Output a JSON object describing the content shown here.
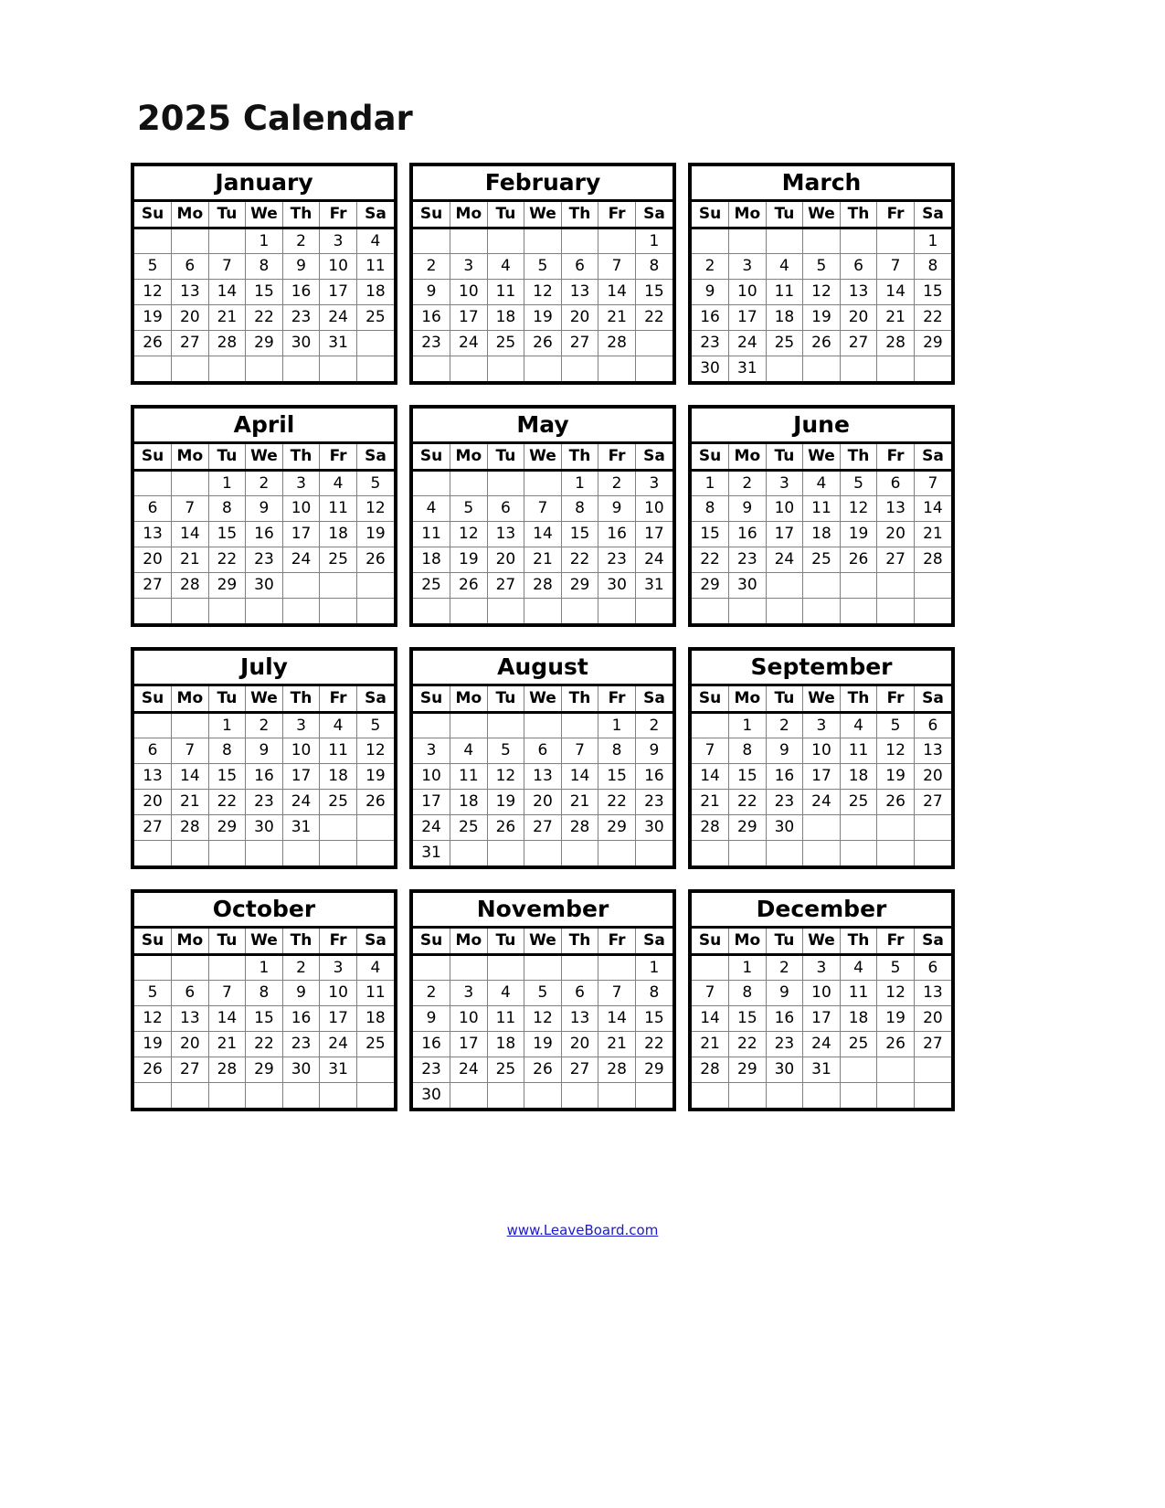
{
  "document": {
    "title": "2025 Calendar",
    "year": 2025
  },
  "weekdays": [
    "Su",
    "Mo",
    "Tu",
    "We",
    "Th",
    "Fr",
    "Sa"
  ],
  "footer": {
    "link_text": "www.LeaveBoard.com",
    "link_color": "#1919D1"
  },
  "months": [
    {
      "name": "January",
      "weeks": [
        [
          "",
          "",
          "",
          "1",
          "2",
          "3",
          "4"
        ],
        [
          "5",
          "6",
          "7",
          "8",
          "9",
          "10",
          "11"
        ],
        [
          "12",
          "13",
          "14",
          "15",
          "16",
          "17",
          "18"
        ],
        [
          "19",
          "20",
          "21",
          "22",
          "23",
          "24",
          "25"
        ],
        [
          "26",
          "27",
          "28",
          "29",
          "30",
          "31",
          ""
        ],
        [
          "",
          "",
          "",
          "",
          "",
          "",
          ""
        ]
      ]
    },
    {
      "name": "February",
      "weeks": [
        [
          "",
          "",
          "",
          "",
          "",
          "",
          "1"
        ],
        [
          "2",
          "3",
          "4",
          "5",
          "6",
          "7",
          "8"
        ],
        [
          "9",
          "10",
          "11",
          "12",
          "13",
          "14",
          "15"
        ],
        [
          "16",
          "17",
          "18",
          "19",
          "20",
          "21",
          "22"
        ],
        [
          "23",
          "24",
          "25",
          "26",
          "27",
          "28",
          ""
        ],
        [
          "",
          "",
          "",
          "",
          "",
          "",
          ""
        ]
      ]
    },
    {
      "name": "March",
      "weeks": [
        [
          "",
          "",
          "",
          "",
          "",
          "",
          "1"
        ],
        [
          "2",
          "3",
          "4",
          "5",
          "6",
          "7",
          "8"
        ],
        [
          "9",
          "10",
          "11",
          "12",
          "13",
          "14",
          "15"
        ],
        [
          "16",
          "17",
          "18",
          "19",
          "20",
          "21",
          "22"
        ],
        [
          "23",
          "24",
          "25",
          "26",
          "27",
          "28",
          "29"
        ],
        [
          "30",
          "31",
          "",
          "",
          "",
          "",
          ""
        ]
      ]
    },
    {
      "name": "April",
      "weeks": [
        [
          "",
          "",
          "1",
          "2",
          "3",
          "4",
          "5"
        ],
        [
          "6",
          "7",
          "8",
          "9",
          "10",
          "11",
          "12"
        ],
        [
          "13",
          "14",
          "15",
          "16",
          "17",
          "18",
          "19"
        ],
        [
          "20",
          "21",
          "22",
          "23",
          "24",
          "25",
          "26"
        ],
        [
          "27",
          "28",
          "29",
          "30",
          "",
          "",
          ""
        ],
        [
          "",
          "",
          "",
          "",
          "",
          "",
          ""
        ]
      ]
    },
    {
      "name": "May",
      "weeks": [
        [
          "",
          "",
          "",
          "",
          "1",
          "2",
          "3"
        ],
        [
          "4",
          "5",
          "6",
          "7",
          "8",
          "9",
          "10"
        ],
        [
          "11",
          "12",
          "13",
          "14",
          "15",
          "16",
          "17"
        ],
        [
          "18",
          "19",
          "20",
          "21",
          "22",
          "23",
          "24"
        ],
        [
          "25",
          "26",
          "27",
          "28",
          "29",
          "30",
          "31"
        ],
        [
          "",
          "",
          "",
          "",
          "",
          "",
          ""
        ]
      ]
    },
    {
      "name": "June",
      "weeks": [
        [
          "1",
          "2",
          "3",
          "4",
          "5",
          "6",
          "7"
        ],
        [
          "8",
          "9",
          "10",
          "11",
          "12",
          "13",
          "14"
        ],
        [
          "15",
          "16",
          "17",
          "18",
          "19",
          "20",
          "21"
        ],
        [
          "22",
          "23",
          "24",
          "25",
          "26",
          "27",
          "28"
        ],
        [
          "29",
          "30",
          "",
          "",
          "",
          "",
          ""
        ],
        [
          "",
          "",
          "",
          "",
          "",
          "",
          ""
        ]
      ]
    },
    {
      "name": "July",
      "weeks": [
        [
          "",
          "",
          "1",
          "2",
          "3",
          "4",
          "5"
        ],
        [
          "6",
          "7",
          "8",
          "9",
          "10",
          "11",
          "12"
        ],
        [
          "13",
          "14",
          "15",
          "16",
          "17",
          "18",
          "19"
        ],
        [
          "20",
          "21",
          "22",
          "23",
          "24",
          "25",
          "26"
        ],
        [
          "27",
          "28",
          "29",
          "30",
          "31",
          "",
          ""
        ],
        [
          "",
          "",
          "",
          "",
          "",
          "",
          ""
        ]
      ]
    },
    {
      "name": "August",
      "weeks": [
        [
          "",
          "",
          "",
          "",
          "",
          "1",
          "2"
        ],
        [
          "3",
          "4",
          "5",
          "6",
          "7",
          "8",
          "9"
        ],
        [
          "10",
          "11",
          "12",
          "13",
          "14",
          "15",
          "16"
        ],
        [
          "17",
          "18",
          "19",
          "20",
          "21",
          "22",
          "23"
        ],
        [
          "24",
          "25",
          "26",
          "27",
          "28",
          "29",
          "30"
        ],
        [
          "31",
          "",
          "",
          "",
          "",
          "",
          ""
        ]
      ]
    },
    {
      "name": "September",
      "weeks": [
        [
          "",
          "1",
          "2",
          "3",
          "4",
          "5",
          "6"
        ],
        [
          "7",
          "8",
          "9",
          "10",
          "11",
          "12",
          "13"
        ],
        [
          "14",
          "15",
          "16",
          "17",
          "18",
          "19",
          "20"
        ],
        [
          "21",
          "22",
          "23",
          "24",
          "25",
          "26",
          "27"
        ],
        [
          "28",
          "29",
          "30",
          "",
          "",
          "",
          ""
        ],
        [
          "",
          "",
          "",
          "",
          "",
          "",
          ""
        ]
      ]
    },
    {
      "name": "October",
      "weeks": [
        [
          "",
          "",
          "",
          "1",
          "2",
          "3",
          "4"
        ],
        [
          "5",
          "6",
          "7",
          "8",
          "9",
          "10",
          "11"
        ],
        [
          "12",
          "13",
          "14",
          "15",
          "16",
          "17",
          "18"
        ],
        [
          "19",
          "20",
          "21",
          "22",
          "23",
          "24",
          "25"
        ],
        [
          "26",
          "27",
          "28",
          "29",
          "30",
          "31",
          ""
        ],
        [
          "",
          "",
          "",
          "",
          "",
          "",
          ""
        ]
      ]
    },
    {
      "name": "November",
      "weeks": [
        [
          "",
          "",
          "",
          "",
          "",
          "",
          "1"
        ],
        [
          "2",
          "3",
          "4",
          "5",
          "6",
          "7",
          "8"
        ],
        [
          "9",
          "10",
          "11",
          "12",
          "13",
          "14",
          "15"
        ],
        [
          "16",
          "17",
          "18",
          "19",
          "20",
          "21",
          "22"
        ],
        [
          "23",
          "24",
          "25",
          "26",
          "27",
          "28",
          "29"
        ],
        [
          "30",
          "",
          "",
          "",
          "",
          "",
          ""
        ]
      ]
    },
    {
      "name": "December",
      "weeks": [
        [
          "",
          "1",
          "2",
          "3",
          "4",
          "5",
          "6"
        ],
        [
          "7",
          "8",
          "9",
          "10",
          "11",
          "12",
          "13"
        ],
        [
          "14",
          "15",
          "16",
          "17",
          "18",
          "19",
          "20"
        ],
        [
          "21",
          "22",
          "23",
          "24",
          "25",
          "26",
          "27"
        ],
        [
          "28",
          "29",
          "30",
          "31",
          "",
          "",
          ""
        ],
        [
          "",
          "",
          "",
          "",
          "",
          "",
          ""
        ]
      ]
    }
  ]
}
